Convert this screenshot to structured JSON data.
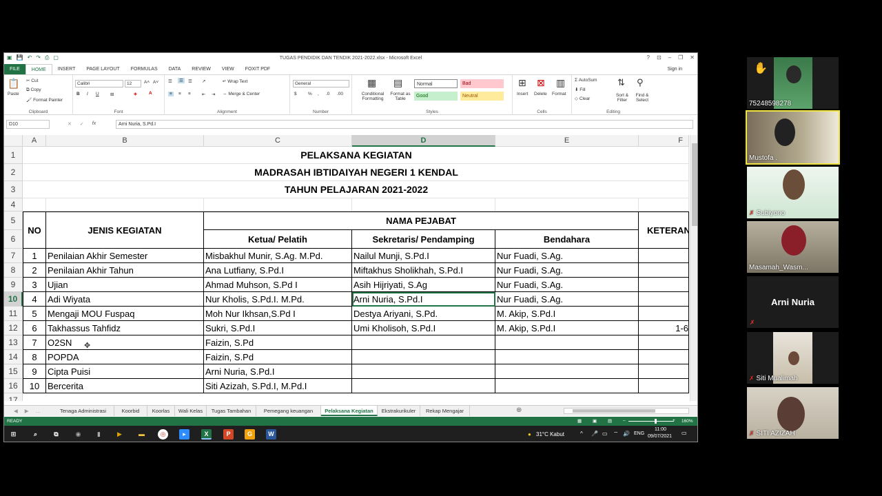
{
  "window": {
    "title": "TUGAS PENDIDIK DAN TENDIK 2021-2022.xlsx - Microsoft Excel",
    "signin": "Sign in"
  },
  "ribbon_tabs": [
    "HOME",
    "INSERT",
    "PAGE LAYOUT",
    "FORMULAS",
    "DATA",
    "REVIEW",
    "VIEW",
    "FOXIT PDF"
  ],
  "file_tab": "FILE",
  "ribbon": {
    "clipboard": {
      "paste": "Paste",
      "cut": "Cut",
      "copy": "Copy",
      "format_painter": "Format Painter",
      "label": "Clipboard"
    },
    "font": {
      "name": "Calibri",
      "size": "12",
      "label": "Font"
    },
    "alignment": {
      "wrap": "Wrap Text",
      "merge": "Merge & Center",
      "label": "Alignment"
    },
    "number": {
      "format": "General",
      "label": "Number"
    },
    "styles": {
      "conditional": "Conditional Formatting",
      "format_table": "Format as Table",
      "normal": "Normal",
      "bad": "Bad",
      "good": "Good",
      "neutral": "Neutral",
      "label": "Styles"
    },
    "cells": {
      "insert": "Insert",
      "delete": "Delete",
      "format": "Format",
      "label": "Cells"
    },
    "editing": {
      "autosum": "AutoSum",
      "fill": "Fill",
      "clear": "Clear",
      "sort": "Sort & Filter",
      "find": "Find & Select",
      "label": "Editing"
    }
  },
  "formula_bar": {
    "cell_ref": "D10",
    "fx": "fx",
    "content": "Arni Nuria, S.Pd.I"
  },
  "columns": [
    "A",
    "B",
    "C",
    "D",
    "E",
    "F"
  ],
  "rows": [
    "1",
    "2",
    "3",
    "4",
    "5",
    "6",
    "7",
    "8",
    "9",
    "10",
    "11",
    "12",
    "13",
    "14",
    "15",
    "16",
    "17"
  ],
  "sheet": {
    "title1": "PELAKSANA KEGIATAN",
    "title2": "MADRASAH IBTIDAIYAH NEGERI 1 KENDAL",
    "title3": "TAHUN PELAJARAN 2021-2022",
    "h_no": "NO",
    "h_jenis": "JENIS KEGIATAN",
    "h_nama": "NAMA PEJABAT",
    "h_ketua": "Ketua/ Pelatih",
    "h_sekretaris": "Sekretaris/ Pendamping",
    "h_bendahara": "Bendahara",
    "h_ket": "KETERAN",
    "data": [
      [
        "1",
        "Penilaian Akhir Semester",
        "Misbakhul Munir, S.Ag. M.Pd.",
        "Nailul Munji, S.Pd.I",
        "Nur Fuadi, S.Ag.",
        ""
      ],
      [
        "2",
        "Penilaian Akhir Tahun",
        "Ana Lutfiany, S.Pd.I",
        "Miftakhus Sholikhah, S.Pd.I",
        "Nur Fuadi, S.Ag.",
        ""
      ],
      [
        "3",
        "Ujian",
        "Ahmad Muhson, S.Pd I",
        "Asih Hijriyati, S.Ag",
        "Nur Fuadi, S.Ag.",
        ""
      ],
      [
        "4",
        "Adi Wiyata",
        "Nur Kholis, S.Pd.I. M.Pd.",
        "Arni Nuria, S.Pd.I",
        "Nur Fuadi, S.Ag.",
        ""
      ],
      [
        "5",
        "Mengaji MOU Fuspaq",
        "Moh Nur Ikhsan,S.Pd I",
        "Destya Ariyani, S.Pd.",
        "M. Akip, S.Pd.I",
        ""
      ],
      [
        "6",
        "Takhassus Tahfidz",
        "Sukri, S.Pd.I",
        "Umi Kholisoh, S.Pd.I",
        "M. Akip, S.Pd.I",
        "1-6"
      ],
      [
        "7",
        "O2SN",
        "Faizin, S.Pd",
        "",
        "",
        ""
      ],
      [
        "8",
        "POPDA",
        "Faizin, S.Pd",
        "",
        "",
        ""
      ],
      [
        "9",
        "Cipta Puisi",
        "Arni Nuria, S.Pd.I",
        "",
        "",
        ""
      ],
      [
        "10",
        "Bercerita",
        "Siti Azizah, S.Pd.I, M.Pd.I",
        "",
        "",
        ""
      ]
    ]
  },
  "sheet_tabs": [
    "Tenaga Administrasi",
    "Koorbid",
    "Koorlas",
    "Wali Kelas",
    "Tugas Tambahan",
    "Pemegang keuangan",
    "Pelaksana Kegiatan",
    "Ekstrakurikuler",
    "Rekap Mengajar"
  ],
  "active_sheet": "Pelaksana Kegiatan",
  "status": {
    "ready": "READY",
    "zoom": "160%"
  },
  "taskbar": {
    "weather": "31°C Kabut",
    "lang": "ENG",
    "time": "11:00",
    "date": "09/07/2021"
  },
  "participants": [
    {
      "name": "75248598278",
      "hand": true
    },
    {
      "name": "Mustofa ."
    },
    {
      "name": "Subiyono"
    },
    {
      "name": "Masamah_Wasm..."
    },
    {
      "name": "Arni Nuria",
      "video_off": true
    },
    {
      "name": "Siti Mualimah",
      "muted": true
    },
    {
      "name": "SITI AZIZAH",
      "muted": true
    }
  ],
  "colors": {
    "excel_green": "#217346",
    "active_speaker": "#f0e442"
  }
}
